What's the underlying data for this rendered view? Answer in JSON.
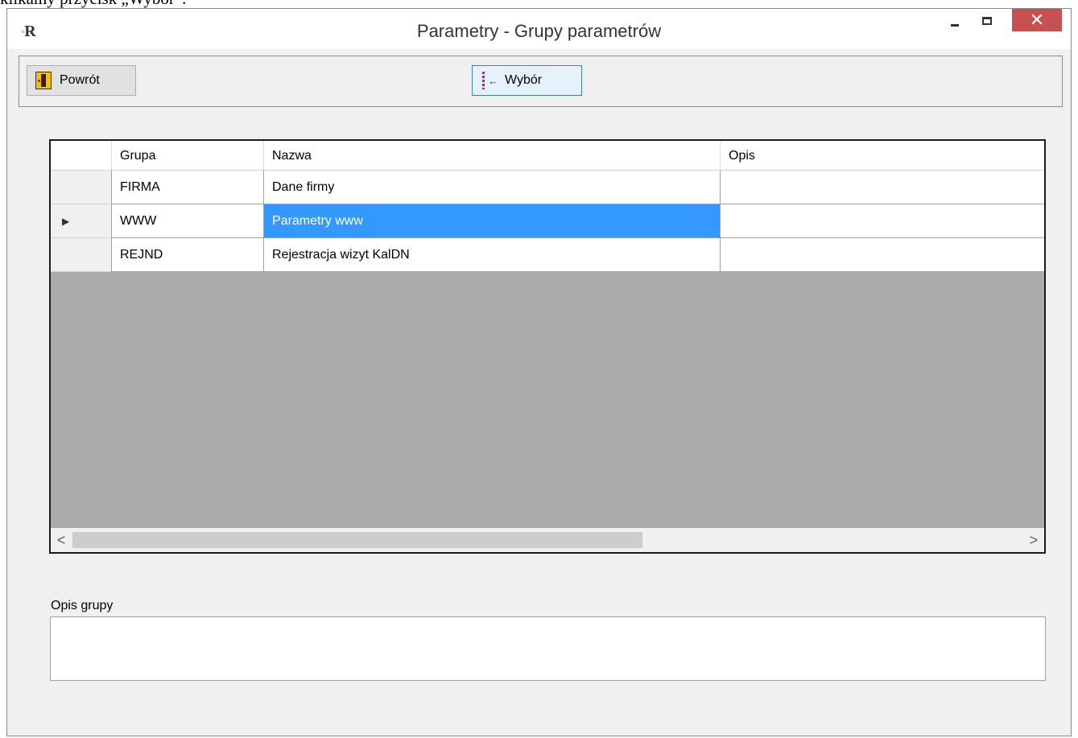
{
  "document_text": "klikamy przycisk „Wybór”.",
  "window": {
    "title": "Parametry - Grupy parametrów",
    "icon_text": "R",
    "minimize_icon": "minimize-icon",
    "maximize_icon": "maximize-icon",
    "close_glyph": "✕"
  },
  "toolbar": {
    "back_label": "Powrót",
    "back_icon": "exit-door-icon",
    "select_label": "Wybór",
    "select_icon": "select-arrow-icon"
  },
  "grid": {
    "columns": [
      "Grupa",
      "Nazwa",
      "Opis"
    ],
    "rows": [
      {
        "grupa": "FIRMA",
        "nazwa": "Dane firmy",
        "opis": ""
      },
      {
        "grupa": "WWW",
        "nazwa": "Parametry www",
        "opis": ""
      },
      {
        "grupa": "REJND",
        "nazwa": "Rejestracja wizyt KalDN",
        "opis": ""
      }
    ],
    "current_row_index": 1,
    "current_row_marker": "▶",
    "selection_color": "#3399ff",
    "scroll": {
      "left_glyph": "<",
      "right_glyph": ">",
      "visible_fraction": 0.6
    }
  },
  "description": {
    "label": "Opis grupy",
    "value": ""
  }
}
